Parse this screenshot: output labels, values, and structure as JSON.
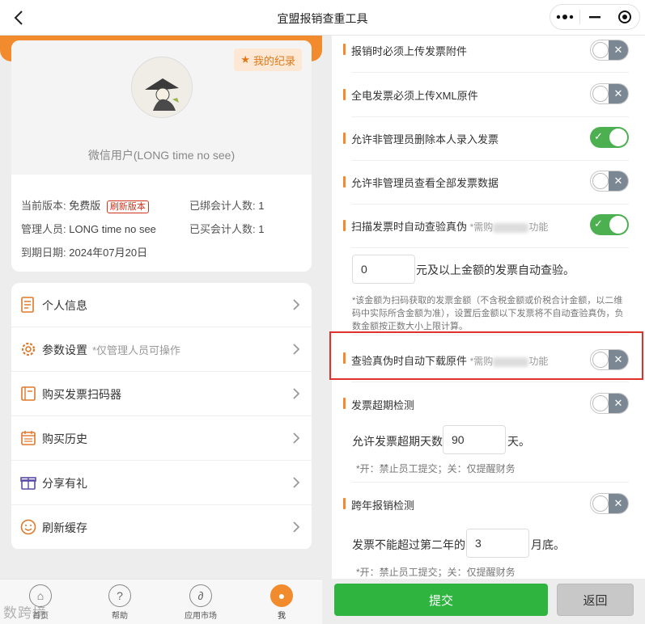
{
  "window": {
    "title": "宜盟报销查重工具"
  },
  "profile": {
    "record_button": "我的纪录",
    "username": "微信用户(LONG time no see)",
    "version_label": "当前版本:",
    "version_value": "免费版",
    "refresh_version": "刷新版本",
    "bound_label": "已绑会计人数:",
    "bound_value": "1",
    "admin_label": "管理人员:",
    "admin_value": "LONG time no see",
    "bought_label": "已买会计人数:",
    "bought_value": "1",
    "expiry_label": "到期日期:",
    "expiry_value": "2024年07月20日"
  },
  "menu": [
    {
      "label": "个人信息",
      "sub": "",
      "icon": "document-icon"
    },
    {
      "label": "参数设置",
      "sub": "*仅管理人员可操作",
      "icon": "gear-icon"
    },
    {
      "label": "购买发票扫码器",
      "sub": "",
      "icon": "book-icon"
    },
    {
      "label": "购买历史",
      "sub": "",
      "icon": "calendar-icon"
    },
    {
      "label": "分享有礼",
      "sub": "",
      "icon": "gift-icon"
    },
    {
      "label": "刷新缓存",
      "sub": "",
      "icon": "smile-icon"
    }
  ],
  "settings": {
    "s1": {
      "label": "报销时必须上传发票附件",
      "on": false
    },
    "s2": {
      "label": "全电发票必须上传XML原件",
      "on": false
    },
    "s3": {
      "label": "允许非管理员删除本人录入发票",
      "on": true
    },
    "s4": {
      "label": "允许非管理员查看全部发票数据",
      "on": false
    },
    "s5": {
      "label": "扫描发票时自动查验真伪",
      "hint_prefix": "*需购",
      "hint_suffix": "功能",
      "on": true
    },
    "amount_value": "0",
    "amount_suffix": "元及以上金额的发票自动查验。",
    "amount_note": "*该金额为扫码获取的发票金额（不含税金额或价税合计金额，以二维码中实际所含金额为准），设置后金额以下发票将不自动查验真伪，负数金额按正数大小上限计算。",
    "s6": {
      "label": "查验真伪时自动下载原件",
      "hint_prefix": "*需购",
      "hint_suffix": "功能",
      "on": false
    },
    "s7": {
      "label": "发票超期检测",
      "on": false
    },
    "overdue_label": "允许发票超期天数",
    "overdue_value": "90",
    "overdue_unit": "天。",
    "overdue_note": "*开：禁止员工提交；关：仅提醒财务",
    "s8": {
      "label": "跨年报销检测",
      "on": false
    },
    "crossyear_label": "发票不能超过第二年的",
    "crossyear_value": "3",
    "crossyear_unit": "月底。",
    "crossyear_note": "*开：禁止员工提交；关：仅提醒财务"
  },
  "tabbar": {
    "home": "首页",
    "help": "帮助",
    "market": "应用市场",
    "me": "我"
  },
  "actions": {
    "submit": "提交",
    "back": "返回"
  },
  "watermark": "数跨境",
  "colors": {
    "accent": "#f28a2e",
    "submit_green": "#2fb440",
    "toggle_on": "#4cb050",
    "highlight_red": "#e0312b"
  }
}
